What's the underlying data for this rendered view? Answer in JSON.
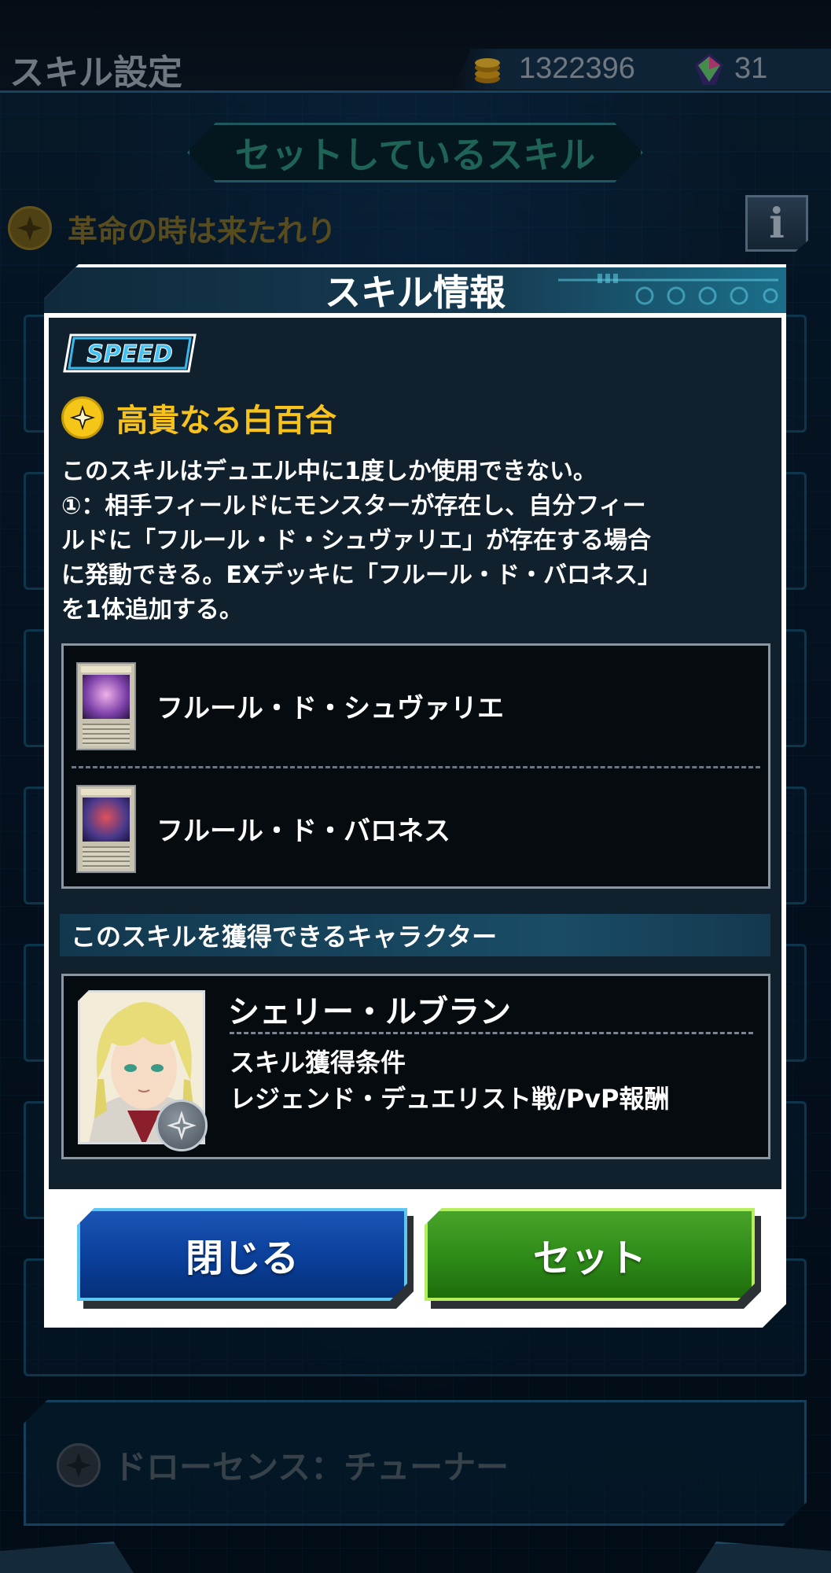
{
  "screen": {
    "title": "スキル設定",
    "coins": "1322396",
    "gems": "31",
    "section_banner": "セットしているスキル",
    "current_skill": "革命の時は来たれり",
    "info_label": "i",
    "lower_skill": "ドローセンス：チューナー"
  },
  "modal": {
    "title": "スキル情報",
    "badge": "SPEED",
    "skill_name": "高貴なる白百合",
    "description_lines": [
      "このスキルはデュエル中に1度しか使用できない。",
      "①：相手フィールドにモンスターが存在し、自分フィー",
      "ルドに「フルール・ド・シュヴァリエ」が存在する場合",
      "に発動できる。EXデッキに「フルール・ド・バロネス」",
      "を1体追加する。"
    ],
    "cards": [
      {
        "name": "フルール・ド・シュヴァリエ",
        "art_color": "#7b3fa8"
      },
      {
        "name": "フルール・ド・バロネス",
        "art_color": "#4a3a8c"
      }
    ],
    "character_section_label": "このスキルを獲得できるキャラクター",
    "character": {
      "name": "シェリー・ルブラン",
      "condition_label": "スキル獲得条件",
      "condition_value": "レジェンド・デュエリスト戦/PvP報酬"
    },
    "buttons": {
      "close": "閉じる",
      "set": "セット"
    }
  },
  "colors": {
    "skill_gold": "#f7c21c",
    "close_button": "#0a3f9a",
    "set_button": "#2d8a18"
  }
}
